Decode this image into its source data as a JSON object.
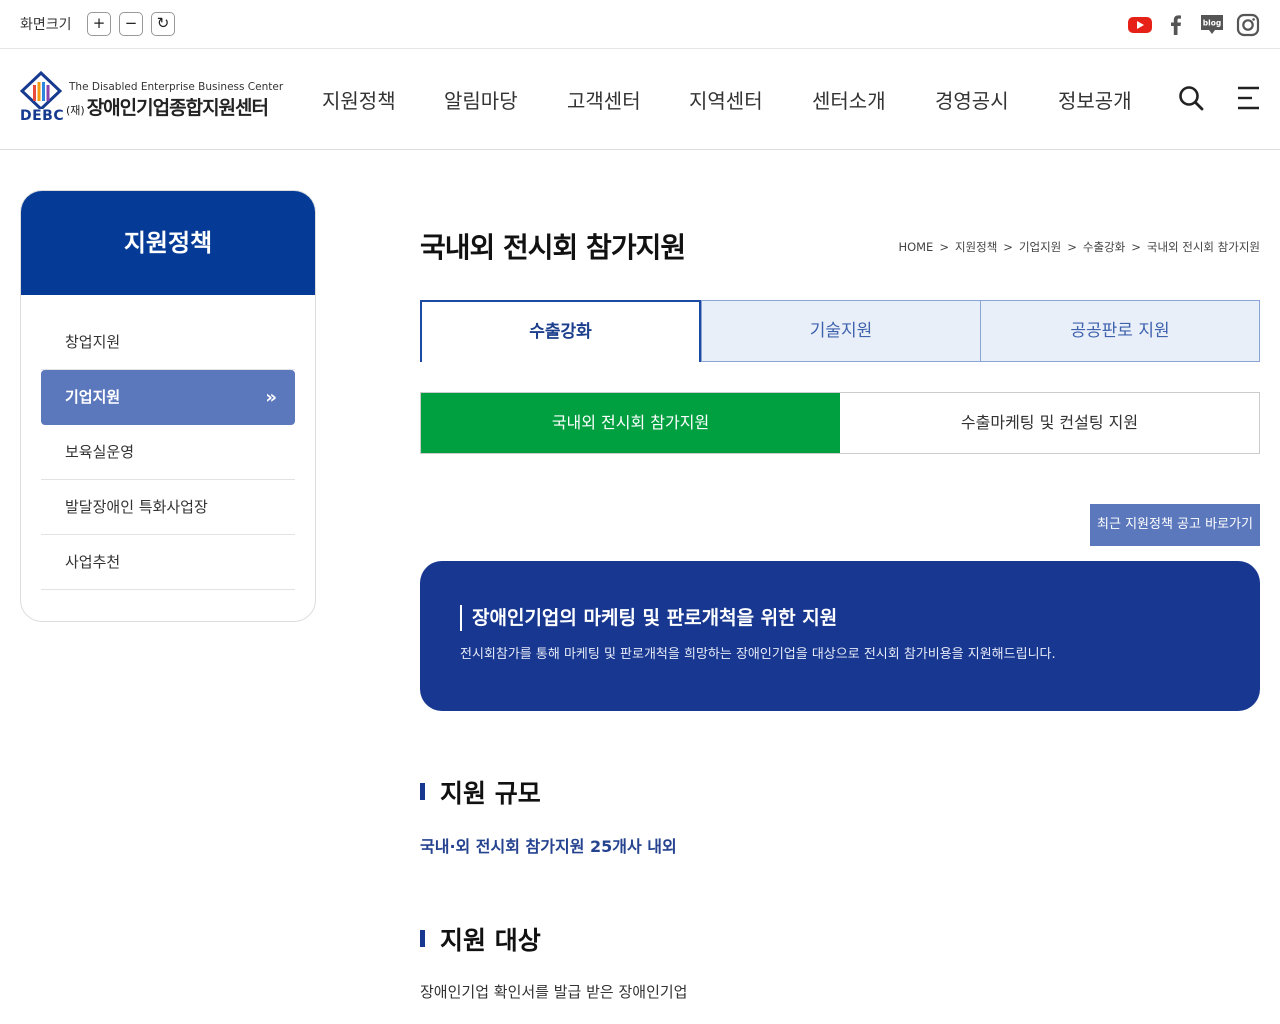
{
  "topbar": {
    "zoom_label": "화면크기",
    "zoom_in": "+",
    "zoom_out": "−",
    "zoom_reset": "↻",
    "social": [
      "youtube-icon",
      "facebook-icon",
      "blog-icon",
      "instagram-icon"
    ],
    "blog_text": "blog"
  },
  "header": {
    "logo_en": "The Disabled Enterprise Business Center",
    "logo_prefix": "(재)",
    "logo_ko": "장애인기업종합지원센터",
    "logo_abbr": "DEBC",
    "nav": [
      "지원정책",
      "알림마당",
      "고객센터",
      "지역센터",
      "센터소개",
      "경영공시",
      "정보공개"
    ]
  },
  "sidebar": {
    "title": "지원정책",
    "items": [
      {
        "label": "창업지원"
      },
      {
        "label": "기업지원",
        "active": true
      },
      {
        "label": "보육실운영"
      },
      {
        "label": "발달장애인 특화사업장"
      },
      {
        "label": "사업추천"
      }
    ]
  },
  "content": {
    "title": "국내외 전시회 참가지원",
    "breadcrumb": [
      "HOME",
      "지원정책",
      "기업지원",
      "수출강화",
      "국내외 전시회 참가지원"
    ],
    "breadcrumb_sep": ">",
    "tabs": [
      {
        "label": "수출강화",
        "active": true
      },
      {
        "label": "기술지원"
      },
      {
        "label": "공공판로 지원"
      }
    ],
    "subtabs": [
      {
        "label": "국내외 전시회 참가지원",
        "active": true
      },
      {
        "label": "수출마케팅 및 컨설팅 지원"
      }
    ],
    "notice_button": "최근 지원정책 공고 바로가기",
    "banner": {
      "title": "장애인기업의 마케팅 및 판로개척을 위한 지원",
      "desc": "전시회참가를 통해 마케팅 및 판로개척을 희망하는 장애인기업을 대상으로 전시회 참가비용을 지원해드립니다."
    },
    "scale": {
      "title": "지원 규모",
      "text": "국내·외 전시회 참가지원 25개사 내외"
    },
    "target": {
      "title": "지원 대상",
      "text": "장애인기업 확인서를 발급 받은 장애인기업"
    }
  },
  "colors": {
    "primary": "#053b96",
    "accent_green": "#00a040",
    "sub_blue": "#5c78bd",
    "banner": "#173790"
  }
}
